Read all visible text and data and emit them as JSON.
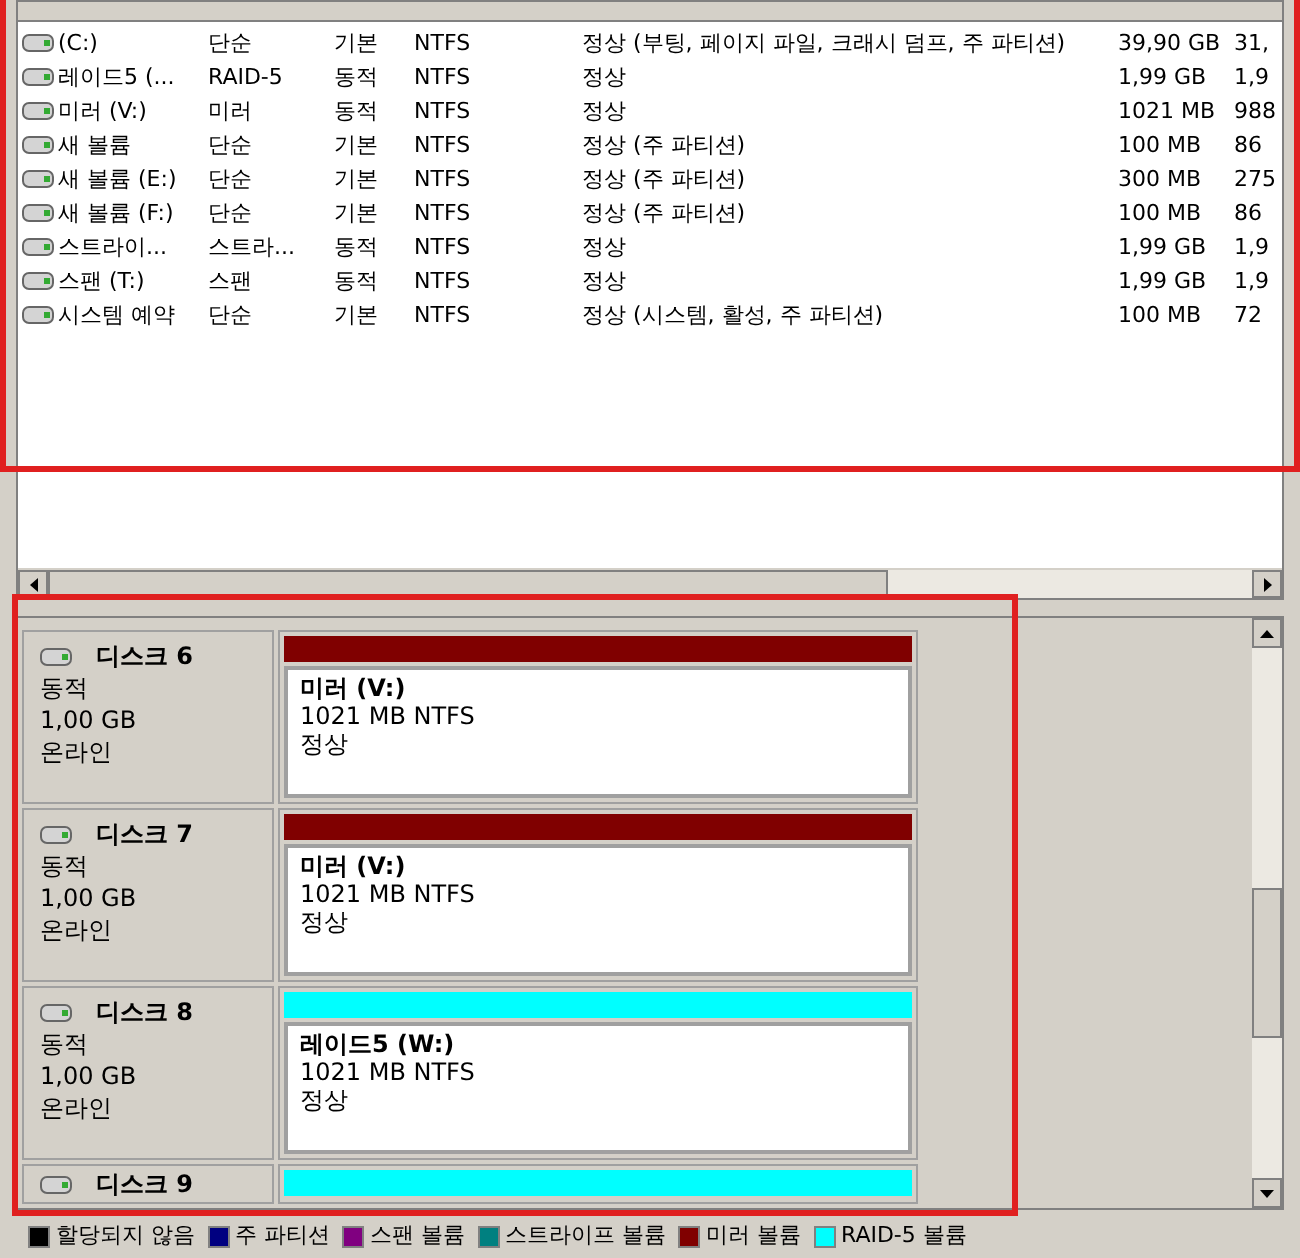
{
  "volumes": [
    {
      "name": "(C:)",
      "layout": "단순",
      "type": "기본",
      "fs": "NTFS",
      "status": "정상 (부팅, 페이지 파일, 크래시 덤프, 주 파티션)",
      "capacity": "39,90 GB",
      "free": "31,"
    },
    {
      "name": "레이드5 (...",
      "layout": "RAID-5",
      "type": "동적",
      "fs": "NTFS",
      "status": "정상",
      "capacity": "1,99 GB",
      "free": "1,9"
    },
    {
      "name": "미러 (V:)",
      "layout": "미러",
      "type": "동적",
      "fs": "NTFS",
      "status": "정상",
      "capacity": "1021 MB",
      "free": "988"
    },
    {
      "name": "새 볼륨",
      "layout": "단순",
      "type": "기본",
      "fs": "NTFS",
      "status": "정상 (주 파티션)",
      "capacity": "100 MB",
      "free": "86"
    },
    {
      "name": "새 볼륨 (E:)",
      "layout": "단순",
      "type": "기본",
      "fs": "NTFS",
      "status": "정상 (주 파티션)",
      "capacity": "300 MB",
      "free": "275"
    },
    {
      "name": "새 볼륨 (F:)",
      "layout": "단순",
      "type": "기본",
      "fs": "NTFS",
      "status": "정상 (주 파티션)",
      "capacity": "100 MB",
      "free": "86"
    },
    {
      "name": "스트라이...",
      "layout": "스트라...",
      "type": "동적",
      "fs": "NTFS",
      "status": "정상",
      "capacity": "1,99 GB",
      "free": "1,9"
    },
    {
      "name": "스팬 (T:)",
      "layout": "스팬",
      "type": "동적",
      "fs": "NTFS",
      "status": "정상",
      "capacity": "1,99 GB",
      "free": "1,9"
    },
    {
      "name": "시스템 예약",
      "layout": "단순",
      "type": "기본",
      "fs": "NTFS",
      "status": "정상 (시스템, 활성, 주 파티션)",
      "capacity": "100 MB",
      "free": "72"
    }
  ],
  "disks": [
    {
      "name": "디스크 6",
      "type": "동적",
      "size": "1,00 GB",
      "state": "온라인",
      "color": "#800000",
      "volume": {
        "label": "미러  (V:)",
        "detail": "1021 MB NTFS",
        "status": "정상"
      }
    },
    {
      "name": "디스크 7",
      "type": "동적",
      "size": "1,00 GB",
      "state": "온라인",
      "color": "#800000",
      "volume": {
        "label": "미러  (V:)",
        "detail": "1021 MB NTFS",
        "status": "정상"
      }
    },
    {
      "name": "디스크 8",
      "type": "동적",
      "size": "1,00 GB",
      "state": "온라인",
      "color": "#00ffff",
      "volume": {
        "label": "레이드5  (W:)",
        "detail": "1021 MB NTFS",
        "status": "정상"
      }
    },
    {
      "name": "디스크 9",
      "color": "#00ffff"
    }
  ],
  "legend": [
    {
      "label": "할당되지 않음",
      "color": "#000000"
    },
    {
      "label": "주 파티션",
      "color": "#000080"
    },
    {
      "label": "스팬 볼륨",
      "color": "#800080"
    },
    {
      "label": "스트라이프 볼륨",
      "color": "#008080"
    },
    {
      "label": "미러 볼륨",
      "color": "#800000"
    },
    {
      "label": "RAID-5 볼륨",
      "color": "#00ffff"
    }
  ]
}
